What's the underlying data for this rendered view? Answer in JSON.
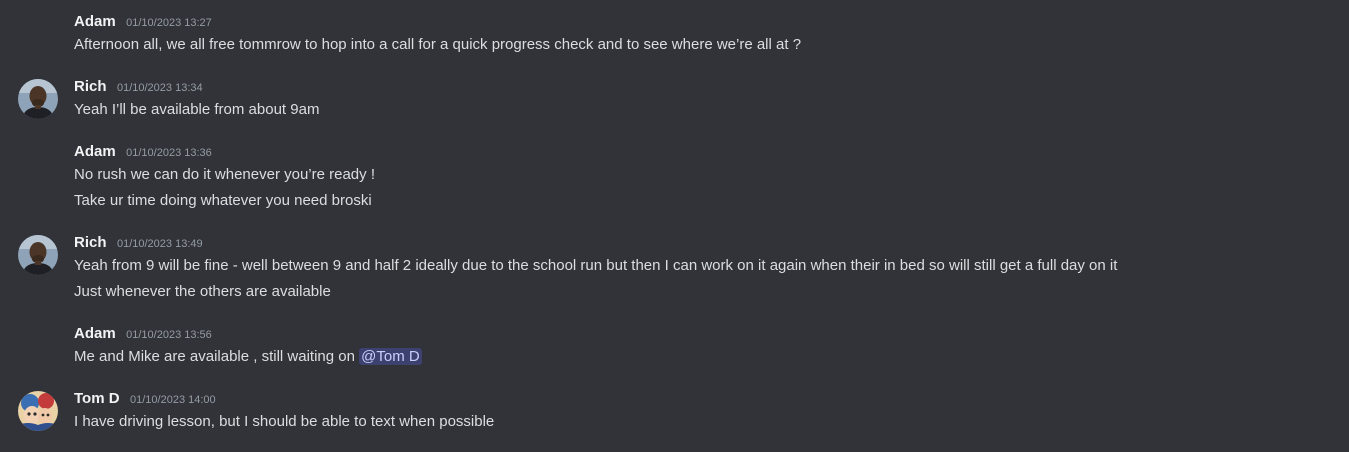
{
  "messages": [
    {
      "author": "Adam",
      "timestamp": "01/10/2023 13:27",
      "lines": [
        "Afternoon all, we all free tommrow to hop into a call for a quick progress check and to see where we’re all at ?"
      ]
    },
    {
      "author": "Rich",
      "avatar": "rich-avatar",
      "timestamp": "01/10/2023 13:34",
      "lines": [
        "Yeah I’ll be available from about 9am"
      ]
    },
    {
      "author": "Adam",
      "timestamp": "01/10/2023 13:36",
      "lines": [
        "No rush we can do it whenever you’re ready !",
        "Take ur time doing whatever you need broski"
      ]
    },
    {
      "author": "Rich",
      "avatar": "rich-avatar",
      "timestamp": "01/10/2023 13:49",
      "lines": [
        "Yeah from 9 will be fine - well between 9 and half 2 ideally due to the school run but then I can work on it again when their in bed so will still get a full day on it",
        "Just whenever the others are available"
      ]
    },
    {
      "author": "Adam",
      "timestamp": "01/10/2023 13:56",
      "lines": [
        "Me and Mike are available , still waiting on "
      ],
      "mention": "@Tom D"
    },
    {
      "author": "Tom D",
      "avatar": "tom-avatar",
      "timestamp": "01/10/2023 14:00",
      "lines": [
        "I have driving lesson, but I should be able to text when possible"
      ]
    }
  ],
  "colors": {
    "background": "#313338",
    "username": "#f2f3f5",
    "timestamp": "#949ba4",
    "text": "#dbdee1",
    "mention_bg": "#3c4270",
    "mention_text": "#c9cdfb"
  }
}
